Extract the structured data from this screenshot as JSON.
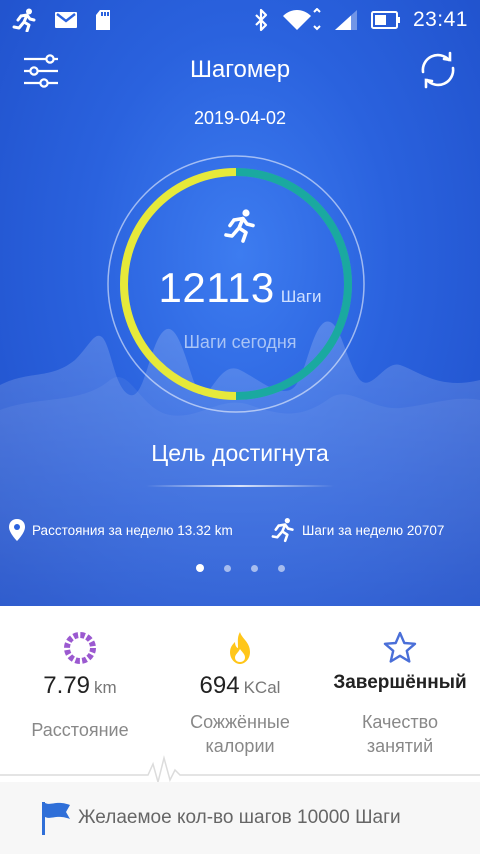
{
  "status_bar": {
    "time": "23:41",
    "icons": [
      "running-icon",
      "gmail-icon",
      "sd-card-icon",
      "bluetooth-icon",
      "wifi-icon",
      "signal-icon",
      "battery-icon"
    ]
  },
  "app_bar": {
    "title": "Шагомер"
  },
  "date": "2019-04-02",
  "today": {
    "steps": "12113",
    "steps_unit": "Шаги",
    "label": "Шаги сегодня",
    "goal_progress": 1.0
  },
  "goal_status": "Цель достигнута",
  "weekly": {
    "distance_text": "Расстояния за неделю 13.32 km",
    "steps_text": "Шаги за неделю 20707"
  },
  "pager": {
    "count": 4,
    "active_index": 0
  },
  "stats": {
    "distance": {
      "value": "7.79",
      "unit": "km",
      "label": "Расстояние"
    },
    "calories": {
      "value": "694",
      "unit": "KCal",
      "label_line1": "Сожжённые",
      "label_line2": "калории"
    },
    "quality": {
      "value": "Завершённый",
      "label_line1": "Качество",
      "label_line2": "занятий"
    }
  },
  "target": {
    "text": "Желаемое кол-во шагов 10000 Шаги"
  },
  "colors": {
    "background_blue": "#2a62de",
    "ring_start": "#e6e93a",
    "ring_end": "#1aa9a0",
    "distance_icon": "#9b59d0",
    "calories_icon": "#ffc61a",
    "quality_icon": "#4a6fd8",
    "flag_icon": "#2f6fd8"
  }
}
